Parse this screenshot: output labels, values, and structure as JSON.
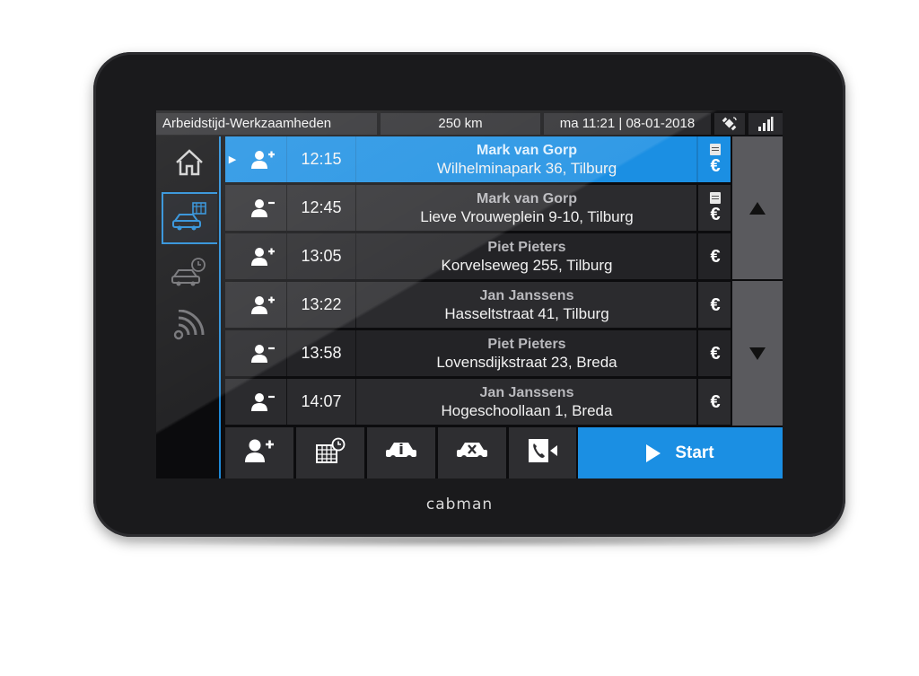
{
  "statusbar": {
    "title": "Arbeidstijd-Werkzaamheden",
    "distance": "250 km",
    "datetime": "ma 11:21 | 08-01-2018",
    "gps_icon": "gps-satellite-icon",
    "signal_icon": "signal-bars-icon"
  },
  "nav": {
    "items": [
      {
        "name": "home",
        "icon": "home-icon",
        "active": false
      },
      {
        "name": "rides",
        "icon": "taxi-calendar-icon",
        "active": true
      },
      {
        "name": "history",
        "icon": "taxi-clock-icon",
        "active": false
      },
      {
        "name": "connection",
        "icon": "wireless-icon",
        "active": false
      }
    ]
  },
  "rides": [
    {
      "action": "pickup",
      "time": "12:15",
      "name": "Mark van Gorp",
      "address": "Wilhelminapark 36, Tilburg",
      "has_document": true,
      "payment": "€",
      "selected": true
    },
    {
      "action": "dropoff",
      "time": "12:45",
      "name": "Mark van Gorp",
      "address": "Lieve Vrouweplein 9-10, Tilburg",
      "has_document": true,
      "payment": "€",
      "selected": false
    },
    {
      "action": "pickup",
      "time": "13:05",
      "name": "Piet Pieters",
      "address": "Korvelseweg 255, Tilburg",
      "has_document": false,
      "payment": "€",
      "selected": false
    },
    {
      "action": "pickup",
      "time": "13:22",
      "name": "Jan Janssens",
      "address": "Hasseltstraat 41, Tilburg",
      "has_document": false,
      "payment": "€",
      "selected": false
    },
    {
      "action": "dropoff",
      "time": "13:58",
      "name": "Piet Pieters",
      "address": "Lovensdijkstraat 23, Breda",
      "has_document": false,
      "payment": "€",
      "selected": false
    },
    {
      "action": "dropoff",
      "time": "14:07",
      "name": "Jan Janssens",
      "address": "Hogeschoollaan 1, Breda",
      "has_document": false,
      "payment": "€",
      "selected": false
    }
  ],
  "toolbar": {
    "buttons": [
      "add-passenger-icon",
      "calendar-clock-icon",
      "taxi-info-icon",
      "taxi-cancel-icon",
      "phone-video-icon"
    ],
    "start_label": "Start"
  },
  "brand": "cabman",
  "colors": {
    "accent": "#1b8fe3",
    "nav_accent": "#1e88d6"
  }
}
